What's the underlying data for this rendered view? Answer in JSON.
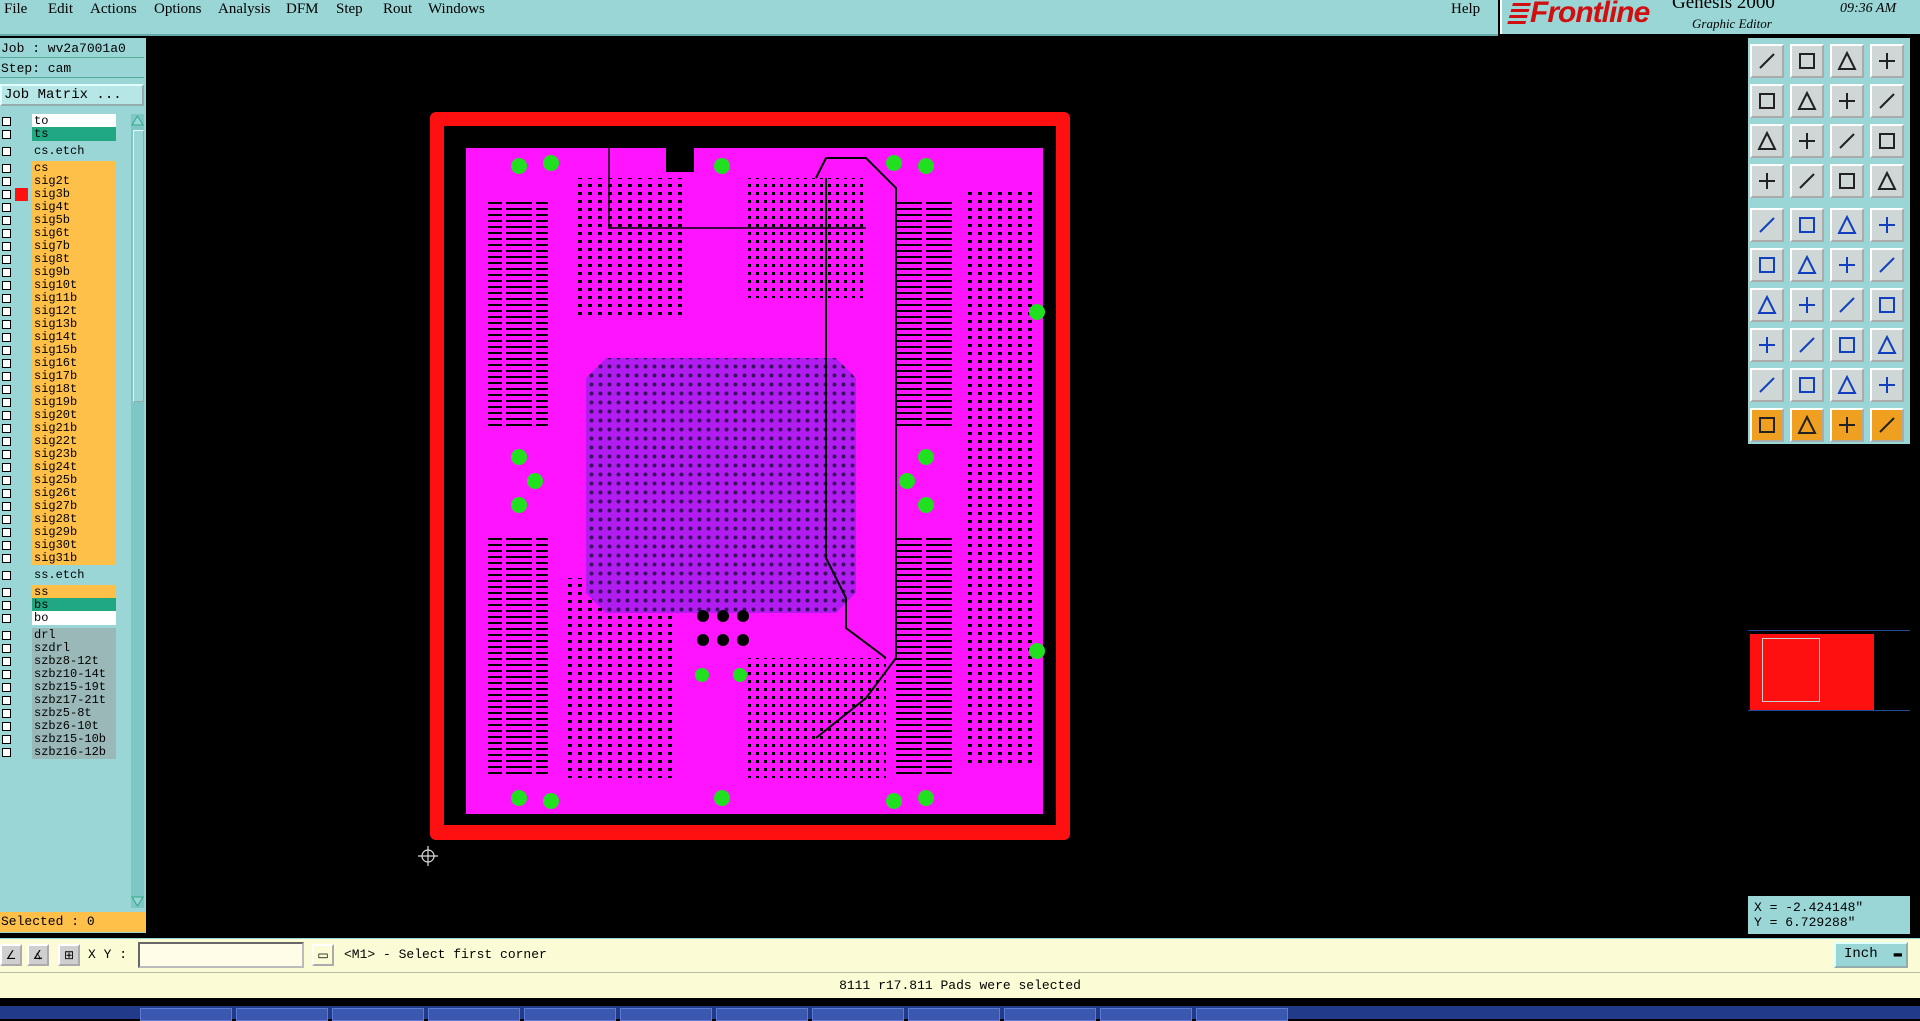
{
  "menubar": {
    "items": [
      "File",
      "Edit",
      "Actions",
      "Options",
      "Analysis",
      "DFM",
      "Step",
      "Rout",
      "Windows"
    ],
    "help": "Help"
  },
  "brand": {
    "logo": "Frontline",
    "product": "Genesis 2000",
    "subtitle": "Graphic Editor",
    "time": "09:36 AM"
  },
  "left_panel": {
    "job": "Job : wv2a7001a0",
    "step": "Step: cam",
    "job_matrix": "Job Matrix ...",
    "layers": [
      {
        "name": "to",
        "color": "#ffffff"
      },
      {
        "name": "ts",
        "color": "#1fa882"
      },
      {
        "name": "cs.etch",
        "color": "#9ad6d6"
      },
      {
        "name": "cs",
        "color": "#ffc04a"
      },
      {
        "name": "sig2t",
        "color": "#ffc04a"
      },
      {
        "name": "sig3b",
        "color": "#ffc04a",
        "active": true
      },
      {
        "name": "sig4t",
        "color": "#ffc04a"
      },
      {
        "name": "sig5b",
        "color": "#ffc04a"
      },
      {
        "name": "sig6t",
        "color": "#ffc04a"
      },
      {
        "name": "sig7b",
        "color": "#ffc04a"
      },
      {
        "name": "sig8t",
        "color": "#ffc04a"
      },
      {
        "name": "sig9b",
        "color": "#ffc04a"
      },
      {
        "name": "sig10t",
        "color": "#ffc04a"
      },
      {
        "name": "sig11b",
        "color": "#ffc04a"
      },
      {
        "name": "sig12t",
        "color": "#ffc04a"
      },
      {
        "name": "sig13b",
        "color": "#ffc04a"
      },
      {
        "name": "sig14t",
        "color": "#ffc04a"
      },
      {
        "name": "sig15b",
        "color": "#ffc04a"
      },
      {
        "name": "sig16t",
        "color": "#ffc04a"
      },
      {
        "name": "sig17b",
        "color": "#ffc04a"
      },
      {
        "name": "sig18t",
        "color": "#ffc04a"
      },
      {
        "name": "sig19b",
        "color": "#ffc04a"
      },
      {
        "name": "sig20t",
        "color": "#ffc04a"
      },
      {
        "name": "sig21b",
        "color": "#ffc04a"
      },
      {
        "name": "sig22t",
        "color": "#ffc04a"
      },
      {
        "name": "sig23b",
        "color": "#ffc04a"
      },
      {
        "name": "sig24t",
        "color": "#ffc04a"
      },
      {
        "name": "sig25b",
        "color": "#ffc04a"
      },
      {
        "name": "sig26t",
        "color": "#ffc04a"
      },
      {
        "name": "sig27b",
        "color": "#ffc04a"
      },
      {
        "name": "sig28t",
        "color": "#ffc04a"
      },
      {
        "name": "sig29b",
        "color": "#ffc04a"
      },
      {
        "name": "sig30t",
        "color": "#ffc04a"
      },
      {
        "name": "sig31b",
        "color": "#ffc04a"
      },
      {
        "name": "ss.etch",
        "color": "#9ad6d6"
      },
      {
        "name": "ss",
        "color": "#ffc04a"
      },
      {
        "name": "bs",
        "color": "#1fa882"
      },
      {
        "name": "bo",
        "color": "#ffffff"
      },
      {
        "name": "drl",
        "color": "#9ab8b8"
      },
      {
        "name": "szdrl",
        "color": "#9ab8b8"
      },
      {
        "name": "szbz8-12t",
        "color": "#9ab8b8"
      },
      {
        "name": "szbz10-14t",
        "color": "#9ab8b8"
      },
      {
        "name": "szbz15-19t",
        "color": "#9ab8b8"
      },
      {
        "name": "szbz17-21t",
        "color": "#9ab8b8"
      },
      {
        "name": "szbz5-8t",
        "color": "#9ab8b8"
      },
      {
        "name": "szbz6-10t",
        "color": "#9ab8b8"
      },
      {
        "name": "szbz15-10b",
        "color": "#9ab8b8"
      },
      {
        "name": "szbz16-12b",
        "color": "#9ab8b8"
      }
    ],
    "selected": "Selected : 0"
  },
  "command_bar": {
    "xy_label": "X Y :",
    "xy_value": "",
    "prompt": "<M1> - Select first corner",
    "units": "Inch"
  },
  "status": "8111 r17.811 Pads were selected",
  "coords": {
    "x": "X = -2.424148\"",
    "y": "Y = 6.729288\""
  },
  "colors": {
    "board_outline": "#ff1010",
    "copper": "#ff14ff",
    "pad": "#20e020",
    "panel": "#9ad6d6",
    "layer_active": "#ff1010"
  },
  "icons": {
    "cursor": "crosshair-cursor-icon",
    "tools": [
      "zoom-home-icon",
      "pan-icon",
      "redraw-icon",
      "measure-icon",
      "select-icon",
      "edit-icon",
      "fill-icon",
      "snap-icon"
    ]
  }
}
